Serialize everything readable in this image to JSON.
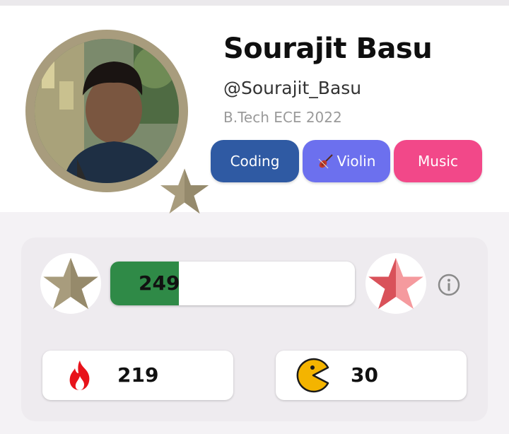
{
  "profile": {
    "name": "Sourajit Basu",
    "handle": "@Sourajit_Basu",
    "subtitle": "B.Tech ECE 2022",
    "interests": [
      {
        "label": "Coding",
        "color": "#2f5aa3"
      },
      {
        "label": "Violin",
        "color": "#6c70ee",
        "icon": "violin-icon"
      },
      {
        "label": "Music",
        "color": "#f24889"
      }
    ]
  },
  "stats": {
    "progress": {
      "value": "249",
      "fill_fraction": 0.28,
      "color": "#2f8a47"
    },
    "current_star_color": "#a89c7d",
    "next_star_color": "#e0525a",
    "streak": {
      "icon": "fire-icon",
      "value": "219"
    },
    "games": {
      "icon": "pacman-icon",
      "value": "30"
    }
  }
}
